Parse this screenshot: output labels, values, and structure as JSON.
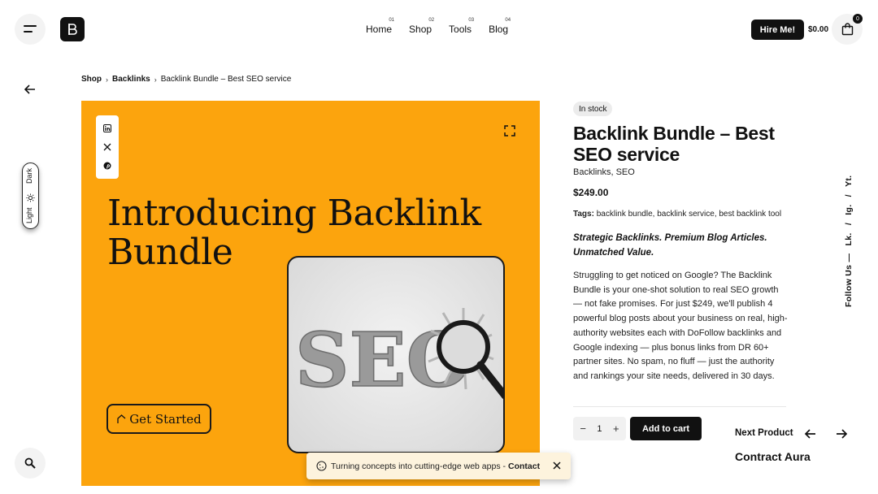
{
  "header": {
    "nav": [
      {
        "label": "Home",
        "num": "01"
      },
      {
        "label": "Shop",
        "num": "02"
      },
      {
        "label": "Tools",
        "num": "03"
      },
      {
        "label": "Blog",
        "num": "04"
      }
    ],
    "hire_label": "Hire Me!",
    "cart_total": "$0.00",
    "cart_count": "0"
  },
  "mode_toggle": {
    "dark": "Dark",
    "light": "Light"
  },
  "breadcrumb": {
    "shop": "Shop",
    "category": "Backlinks",
    "current": "Backlink Bundle – Best SEO service"
  },
  "hero": {
    "title": "Introducing Backlink Bundle",
    "seo_text": "SEO",
    "cta": "Get Started"
  },
  "product": {
    "stock": "In stock",
    "title": "Backlink Bundle – Best SEO service",
    "categories": "Backlinks, SEO",
    "price": "$249.00",
    "tags_label": "Tags:",
    "tags": [
      "backlink bundle",
      "backlink service",
      "best backlink tool"
    ],
    "tagline": "Strategic Backlinks. Premium Blog Articles. Unmatched Value.",
    "description": "Struggling to get noticed on Google? The Backlink Bundle is your one-shot solution to real SEO growth — not fake promises. For just $249, we'll publish 4 powerful blog posts about your business on real, high-authority websites each with DoFollow backlinks and Google indexing — plus bonus links from DR 60+ partner sites. No spam, no fluff — just the authority and rankings your site needs, delivered in 30 days.",
    "quantity": "1",
    "add_to_cart": "Add to cart"
  },
  "next_product": {
    "label": "Next Product",
    "name": "Contract Aura"
  },
  "follow": {
    "label": "Follow Us —",
    "links": [
      "Lk.",
      "/",
      "Ig.",
      "/",
      "Yt."
    ]
  },
  "toast": {
    "text": "Turning concepts into cutting-edge web apps -",
    "link": "Contact"
  },
  "colors": {
    "hero_bg": "#fca40d",
    "primary": "#111111"
  }
}
